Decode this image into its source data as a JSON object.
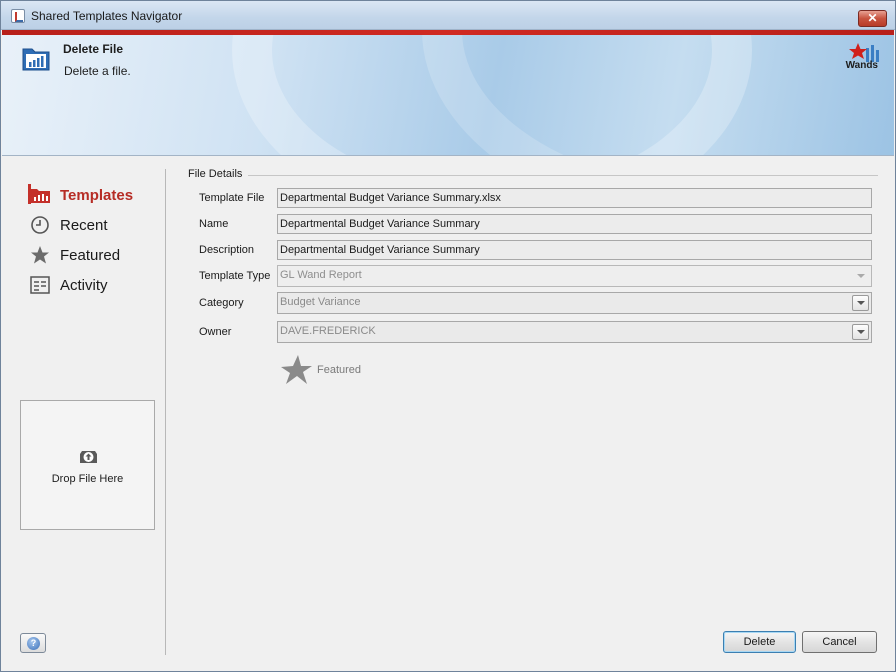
{
  "window": {
    "title": "Shared Templates Navigator",
    "close_label": "✕"
  },
  "banner": {
    "title": "Delete File",
    "subtitle": "Delete a file.",
    "brand_label": "Wands",
    "accent_color": "#c4302a"
  },
  "sidebar": {
    "items": [
      {
        "label": "Templates",
        "icon": "templates-chart-icon",
        "active": true
      },
      {
        "label": "Recent",
        "icon": "clock-icon",
        "active": false
      },
      {
        "label": "Featured",
        "icon": "star-icon",
        "active": false
      },
      {
        "label": "Activity",
        "icon": "activity-list-icon",
        "active": false
      }
    ],
    "drop_zone_label": "Drop File Here",
    "help_label": "?"
  },
  "details": {
    "section_title": "File Details",
    "fields": {
      "template_file": {
        "label": "Template File",
        "value": "Departmental Budget Variance Summary.xlsx"
      },
      "name": {
        "label": "Name",
        "value": "Departmental Budget Variance Summary"
      },
      "description": {
        "label": "Description",
        "value": "Departmental Budget Variance Summary"
      },
      "template_type": {
        "label": "Template Type",
        "value": "GL Wand Report"
      },
      "category": {
        "label": "Category",
        "value": "Budget Variance"
      },
      "owner": {
        "label": "Owner",
        "value": "DAVE.FREDERICK"
      }
    },
    "featured_label": "Featured"
  },
  "buttons": {
    "delete": "Delete",
    "cancel": "Cancel"
  }
}
